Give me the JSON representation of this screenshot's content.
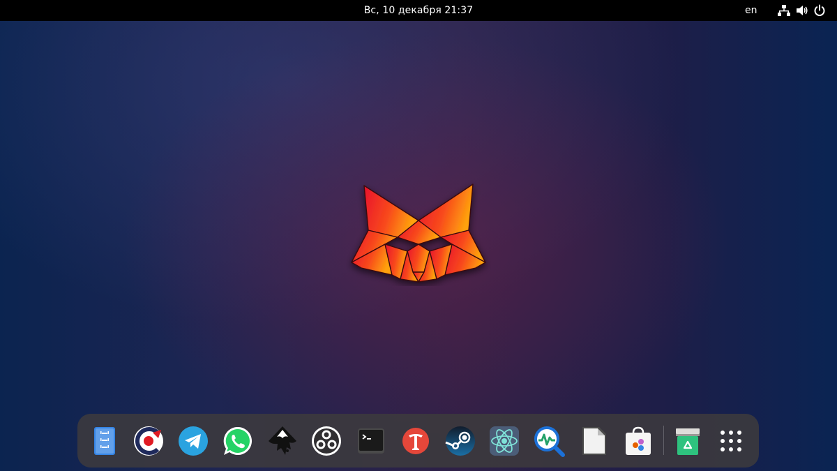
{
  "topbar": {
    "clock": "Вс, 10 декабря  21:37",
    "lang": "en",
    "icons": [
      "network-icon",
      "volume-icon",
      "power-icon"
    ]
  },
  "desktop": {
    "wallpaper_logo": "fox-logo",
    "colors": {
      "top_bar": "#000000",
      "dock": "#3c3a3e",
      "logo_gradient": [
        "#e8142d",
        "#ff9e0f"
      ]
    }
  },
  "dock": {
    "apps": [
      "files-icon",
      "ccleaner-icon",
      "telegram-icon",
      "whatsapp-icon",
      "inkscape-icon",
      "obs-icon",
      "terminal-icon",
      "font-manager-icon",
      "steam-icon",
      "atom-icon",
      "system-monitor-icon",
      "libreoffice-icon",
      "software-store-icon",
      "trash-icon",
      "app-grid-icon"
    ]
  }
}
